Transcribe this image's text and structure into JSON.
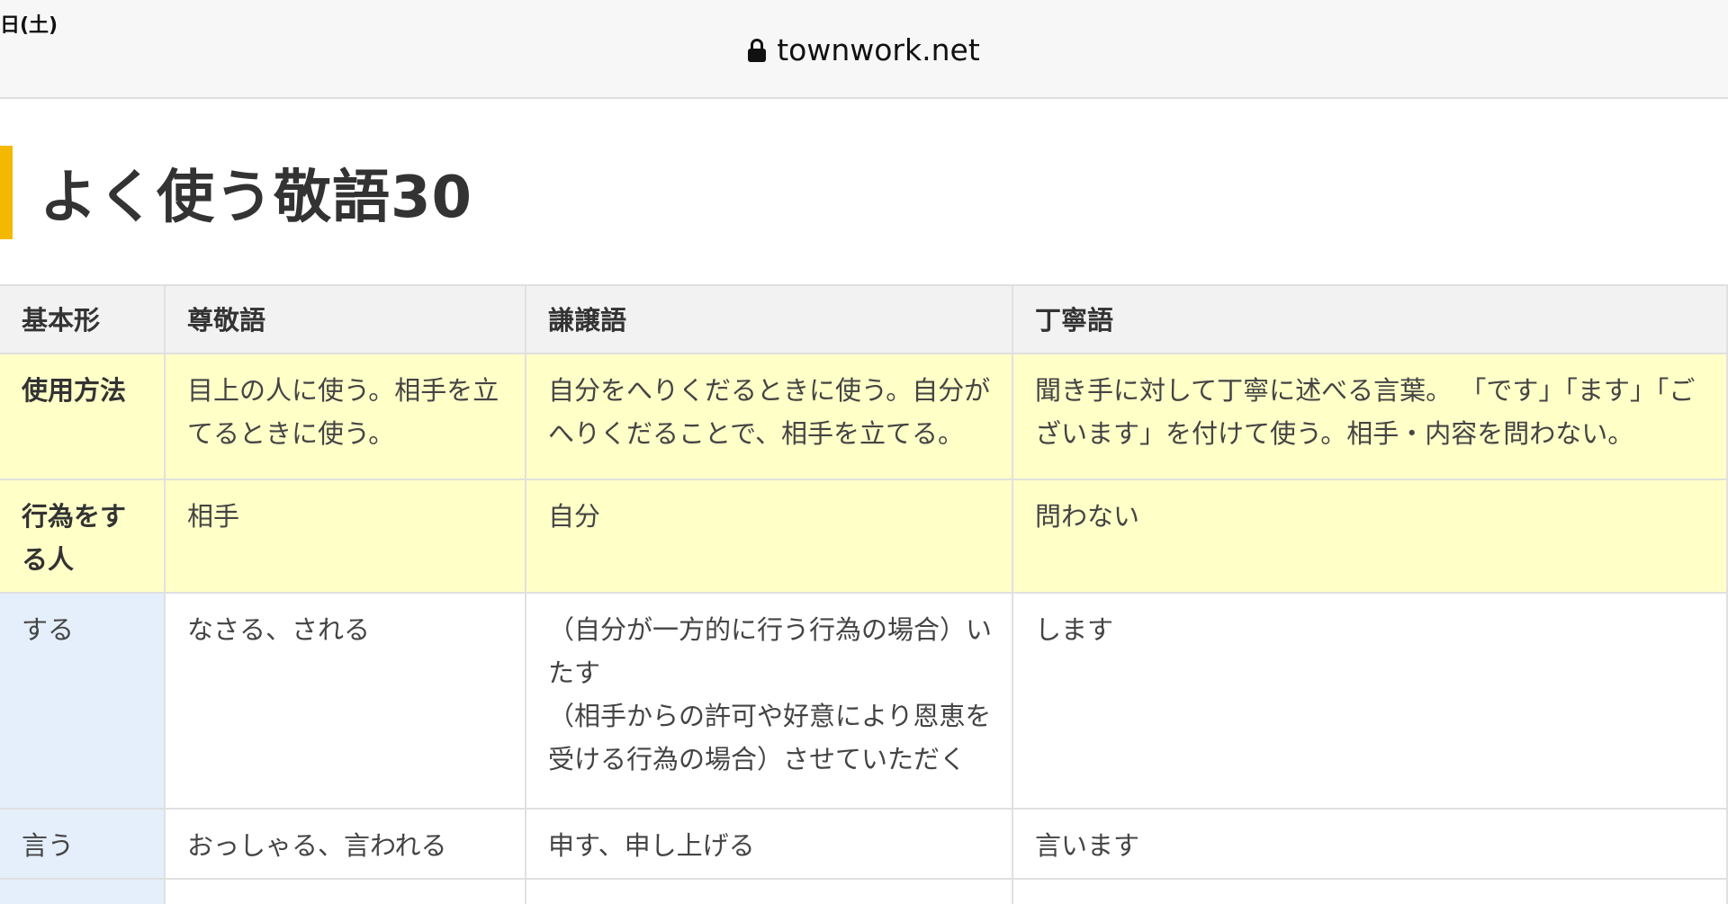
{
  "status_bar": {
    "date_fragment": "日(土)"
  },
  "address_bar": {
    "domain": "townwork.net",
    "lock_icon": "lock-icon"
  },
  "article": {
    "heading": "よく使う敬語30",
    "accent_color": "#f5b800"
  },
  "table": {
    "headers": [
      "基本形",
      "尊敬語",
      "謙譲語",
      "丁寧語"
    ],
    "rows": [
      {
        "key": "使用方法",
        "sonkeigo": "目上の人に使う。相手を立てるときに使う。",
        "kenjougo": "自分をへりくだるときに使う。自分がへりくだることで、相手を立てる。",
        "teineigo": "聞き手に対して丁寧に述べる言葉。 「です」「ます」「ございます」を付けて使う。相手・内容を問わない。"
      },
      {
        "key": "行為をする人",
        "sonkeigo": "相手",
        "kenjougo": "自分",
        "teineigo": "問わない"
      },
      {
        "key": "する",
        "sonkeigo": "なさる、される",
        "kenjougo": "（自分が一方的に行う行為の場合）いたす\n（相手からの許可や好意により恩恵を受ける行為の場合）させていただく",
        "teineigo": "します"
      },
      {
        "key": "言う",
        "sonkeigo": "おっしゃる、言われる",
        "kenjougo": "申す、申し上げる",
        "teineigo": "言います"
      }
    ],
    "colors": {
      "header_bg": "#f2f2f2",
      "highlight_bg": "#ffffc8",
      "key_column_bg": "#e4effb",
      "border": "#e0e0e0"
    }
  }
}
